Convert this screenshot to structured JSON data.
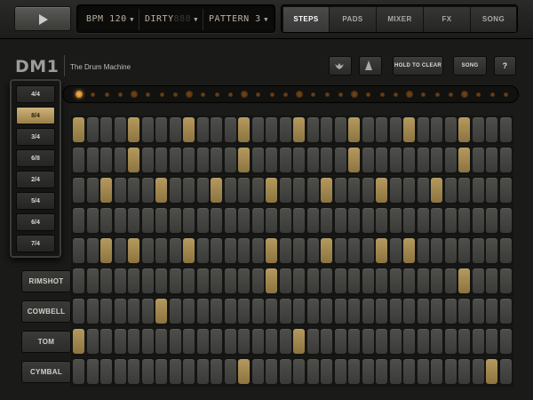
{
  "transport": {
    "play_icon": "play-icon"
  },
  "displays": {
    "bpm": {
      "text": "BPM 120",
      "ghost": ""
    },
    "kit": {
      "text": "DIRTY",
      "ghost": "888"
    },
    "pattern": {
      "text": "PATTERN 3",
      "ghost": ""
    }
  },
  "tabs": [
    {
      "label": "STEPS",
      "active": true
    },
    {
      "label": "PADS",
      "active": false
    },
    {
      "label": "MIXER",
      "active": false
    },
    {
      "label": "FX",
      "active": false
    },
    {
      "label": "SONG",
      "active": false
    }
  ],
  "header": {
    "logo": "DM1",
    "subtitle": "The Drum Machine",
    "hold_to_clear": "HOLD TO CLEAR",
    "song": "SONG",
    "help": "?",
    "bird_icon": "bird-icon",
    "metronome_icon": "metronome-icon"
  },
  "time_signatures": {
    "selected": "8/4",
    "items": [
      "4/4",
      "8/4",
      "3/4",
      "6/8",
      "2/4",
      "5/4",
      "6/4",
      "7/4"
    ]
  },
  "position_leds": {
    "count": 32,
    "current": 0
  },
  "sequencer": {
    "steps": 32,
    "rows": [
      {
        "label": "",
        "on": [
          0,
          4,
          8,
          12,
          16,
          20,
          24,
          28
        ]
      },
      {
        "label": "",
        "on": [
          4,
          12,
          20,
          28
        ]
      },
      {
        "label": "",
        "on": [
          2,
          6,
          10,
          14,
          18,
          22,
          26
        ]
      },
      {
        "label": "",
        "on": []
      },
      {
        "label": "",
        "on": [
          2,
          4,
          8,
          14,
          18,
          22,
          24
        ]
      },
      {
        "label": "RIMSHOT",
        "on": [
          14,
          28
        ]
      },
      {
        "label": "COWBELL",
        "on": [
          6
        ]
      },
      {
        "label": "TOM",
        "on": [
          0,
          16
        ]
      },
      {
        "label": "CYMBAL",
        "on": [
          12,
          30
        ]
      }
    ]
  },
  "colors": {
    "accent": "#b59a5e",
    "led_active": "#f6b85a"
  }
}
